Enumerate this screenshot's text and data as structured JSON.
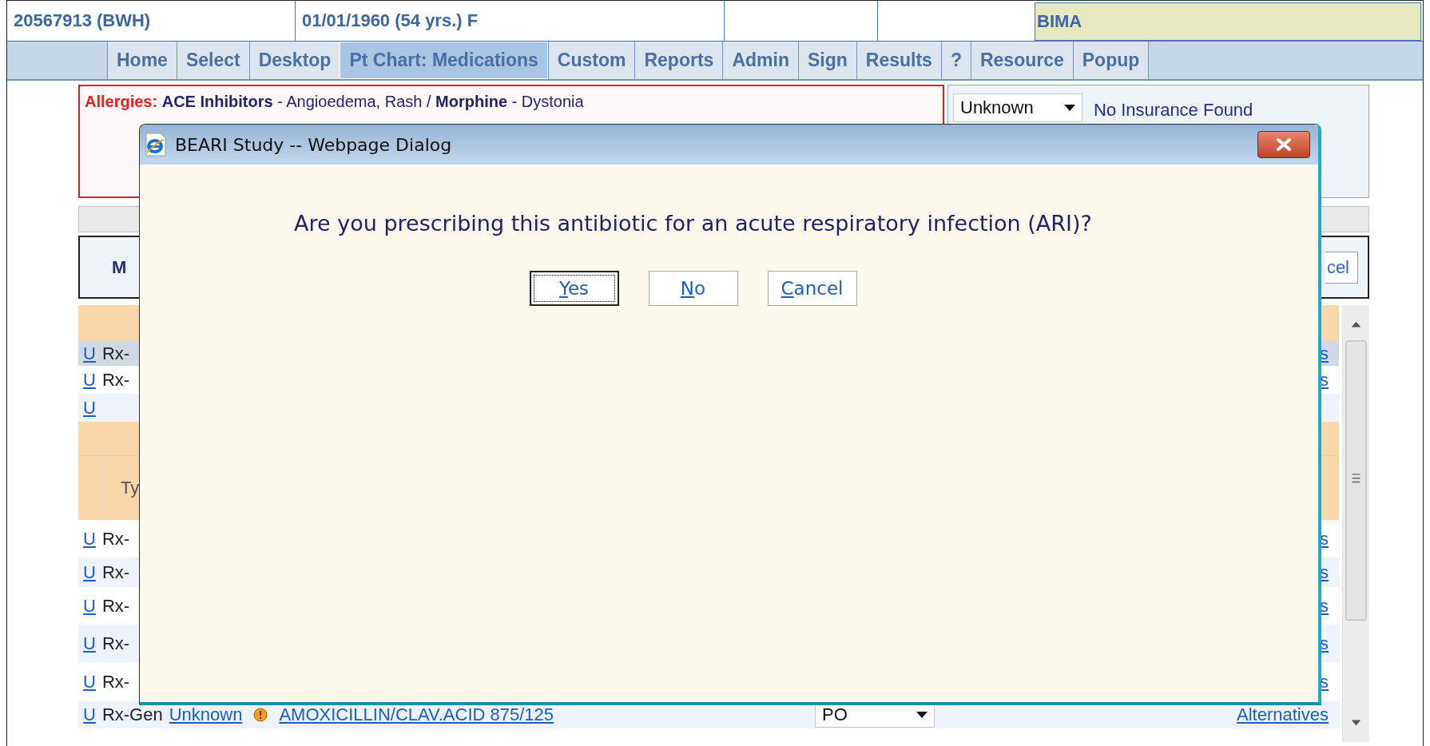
{
  "header": {
    "patient_id": "20567913 (BWH)",
    "patient_info": "01/01/1960 (54 yrs.) F",
    "site": "BIMA"
  },
  "nav": [
    {
      "label": "Home",
      "selected": false
    },
    {
      "label": "Select",
      "selected": false
    },
    {
      "label": "Desktop",
      "selected": false
    },
    {
      "label": "Pt Chart: Medications",
      "selected": true
    },
    {
      "label": "Custom",
      "selected": false
    },
    {
      "label": "Reports",
      "selected": false
    },
    {
      "label": "Admin",
      "selected": false
    },
    {
      "label": "Sign",
      "selected": false
    },
    {
      "label": "Results",
      "selected": false
    },
    {
      "label": "?",
      "selected": false
    },
    {
      "label": "Resource",
      "selected": false
    },
    {
      "label": "Popup",
      "selected": false
    }
  ],
  "allergies": {
    "label": "Allergies:",
    "text": "**ACE Inhibitors** - Angioedema, Rash / **Morphine** - Dystonia"
  },
  "insurance": {
    "coverage": "Unknown",
    "status": "No Insurance Found"
  },
  "med_panel": {
    "title": "M",
    "button": "cel"
  },
  "grid": {
    "rows": [
      {
        "kind": "band"
      },
      {
        "kind": "med",
        "selected": true,
        "action": "U",
        "type": "Rx-",
        "link": "s"
      },
      {
        "kind": "med",
        "selected": false,
        "action": "U",
        "type": "Rx-",
        "link": "s"
      },
      {
        "kind": "med",
        "selected": false,
        "action": "U"
      },
      {
        "kind": "band"
      },
      {
        "kind": "header",
        "column_2": "Ty"
      },
      {
        "kind": "med",
        "selected": false,
        "action": "U",
        "type": "Rx-",
        "link": "s"
      },
      {
        "kind": "med",
        "selected": false,
        "action": "U",
        "type": "Rx-",
        "link": "s"
      },
      {
        "kind": "med",
        "selected": false,
        "action": "U",
        "type": "Rx-",
        "link": "s"
      },
      {
        "kind": "med",
        "selected": false,
        "action": "U",
        "type": "Rx-",
        "link": "s"
      },
      {
        "kind": "med",
        "selected": false,
        "action": "U",
        "type": "Rx-",
        "link": "s"
      },
      {
        "kind": "med",
        "selected": false,
        "action": "U",
        "type": "Rx-Gen",
        "status": "Unknown",
        "drug": "AMOXICILLIN/CLAV.ACID 875/125",
        "route": "PO",
        "link": "Alternatives"
      }
    ]
  },
  "dialog": {
    "title": "BEARI Study -- Webpage Dialog",
    "message": "Are you prescribing this antibiotic for an acute respiratory infection (ARI)?",
    "buttons": [
      {
        "label": "Yes",
        "focused": true
      },
      {
        "label": "No",
        "focused": false
      },
      {
        "label": "Cancel",
        "focused": false
      }
    ]
  }
}
